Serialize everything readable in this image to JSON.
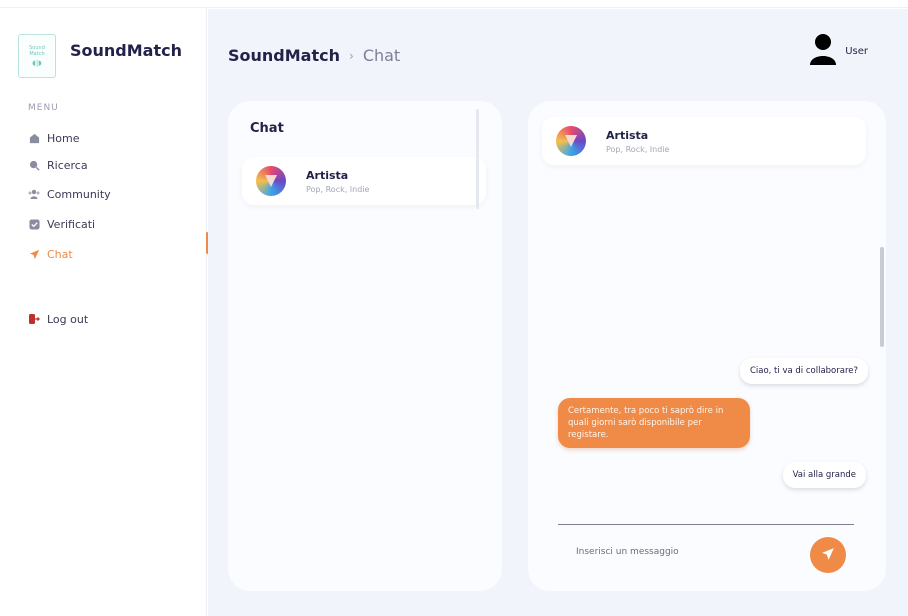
{
  "brand": {
    "name": "SoundMatch",
    "logo_line1": "Sound",
    "logo_line2": "Match",
    "logo_wave": "◖|◗"
  },
  "sidebar": {
    "menu_label": "MENU",
    "items": [
      {
        "label": "Home",
        "icon": "home-icon"
      },
      {
        "label": "Ricerca",
        "icon": "search-icon"
      },
      {
        "label": "Community",
        "icon": "community-icon"
      },
      {
        "label": "Verificati",
        "icon": "verified-icon"
      },
      {
        "label": "Chat",
        "icon": "send-icon"
      }
    ],
    "active_item": "Chat",
    "logout_label": "Log out"
  },
  "header": {
    "breadcrumb_root": "SoundMatch",
    "breadcrumb_sep": "›",
    "breadcrumb_current": "Chat",
    "user_name": "User"
  },
  "chat_list": {
    "title": "Chat",
    "items": [
      {
        "name": "Artista",
        "genres": "Pop, Rock, Indie"
      }
    ]
  },
  "conversation": {
    "contact_name": "Artista",
    "contact_genres": "Pop, Rock, Indie",
    "messages": [
      {
        "direction": "in",
        "text": "Ciao, ti va di collaborare?"
      },
      {
        "direction": "out",
        "text": "Certamente, tra poco ti saprò dire in quali giorni sarò disponibile per registare."
      },
      {
        "direction": "in",
        "text": "Vai alla grande"
      }
    ],
    "input_placeholder": "Inserisci un messaggio"
  },
  "colors": {
    "accent": "#ef8a47",
    "text_dark": "#23234a",
    "background": "#f2f4fb"
  }
}
